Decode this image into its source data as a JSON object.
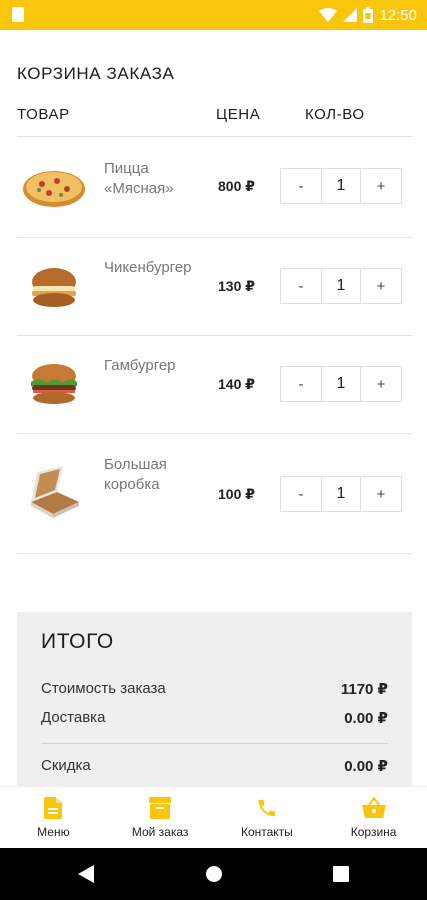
{
  "status": {
    "time": "12:50"
  },
  "cart": {
    "title": "КОРЗИНА ЗАКАЗА",
    "headers": {
      "product": "ТОВАР",
      "price": "ЦЕНА",
      "qty": "КОЛ-ВО"
    },
    "items": [
      {
        "name_line1": "Пицца",
        "name_line2": "«Мясная»",
        "price": "800 ₽",
        "qty": "1",
        "minus": "-",
        "plus": "+"
      },
      {
        "name_line1": "Чикенбургер",
        "name_line2": "",
        "price": "130 ₽",
        "qty": "1",
        "minus": "-",
        "plus": "+"
      },
      {
        "name_line1": "Гамбургер",
        "name_line2": "",
        "price": "140 ₽",
        "qty": "1",
        "minus": "-",
        "plus": "+"
      },
      {
        "name_line1": "Большая",
        "name_line2": "коробка",
        "price": "100 ₽",
        "qty": "1",
        "minus": "-",
        "plus": "+"
      }
    ]
  },
  "summary": {
    "title": "ИТОГО",
    "order_cost_label": "Стоимость заказа",
    "order_cost_value": "1170 ₽",
    "delivery_label": "Доставка",
    "delivery_value": "0.00 ₽",
    "discount_label": "Скидка",
    "discount_value": "0.00 ₽"
  },
  "nav": {
    "accent": "#f9c60b",
    "items": [
      {
        "label": "Меню",
        "icon": "document-icon"
      },
      {
        "label": "Мой заказ",
        "icon": "archive-box-icon"
      },
      {
        "label": "Контакты",
        "icon": "phone-icon"
      },
      {
        "label": "Корзина",
        "icon": "basket-icon"
      }
    ]
  }
}
